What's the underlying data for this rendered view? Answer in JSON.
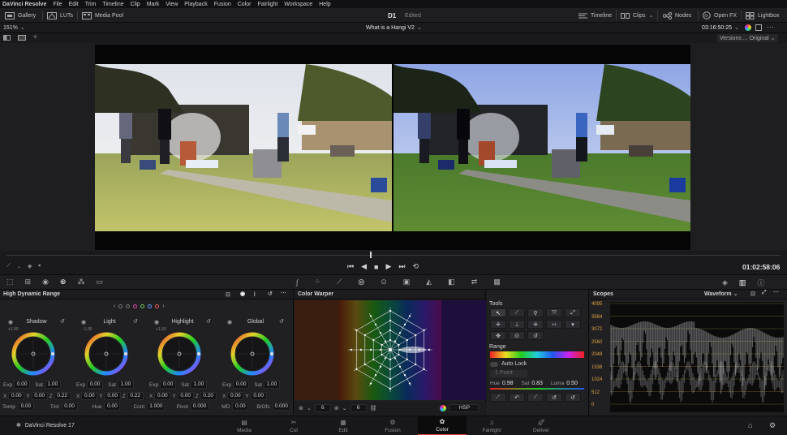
{
  "menubar": {
    "items": [
      "DaVinci Resolve",
      "File",
      "Edit",
      "Trim",
      "Timeline",
      "Clip",
      "Mark",
      "View",
      "Playback",
      "Fusion",
      "Color",
      "Fairlight",
      "Workspace",
      "Help"
    ]
  },
  "toolbar": {
    "gallery": "Gallery",
    "luts": "LUTs",
    "media_pool": "Media Pool",
    "project": "D1",
    "project_status": "Edited",
    "timeline": "Timeline",
    "clips": "Clips",
    "nodes": "Nodes",
    "open_fx": "Open FX",
    "lightbox": "Lightbox"
  },
  "viewer": {
    "zoom": "151%",
    "clip_title": "What is a Hangi V2",
    "timecode": "03:16:50:25",
    "versions": "Versions ... Original",
    "playhead_timecode": "01:02:58:06"
  },
  "hdr": {
    "title": "High Dynamic Range",
    "wheels": [
      {
        "name": "Shadow",
        "offset": "",
        "exp": "0.00",
        "sat": "1.00",
        "x": "0.00",
        "y": "0.00",
        "z": "0.22"
      },
      {
        "name": "Light",
        "offset": "-1.00",
        "exp": "0.00",
        "sat": "1.00",
        "x": "0.00",
        "y": "0.00",
        "z": "0.22"
      },
      {
        "name": "Highlight",
        "offset": "+1.50",
        "exp": "0.00",
        "sat": "1.00",
        "x": "0.00",
        "y": "0.00",
        "z": "0.20"
      },
      {
        "name": "Global",
        "offset": "",
        "exp": "0.00",
        "sat": "1.00",
        "x": "0.00",
        "y": "0.00",
        "z": ""
      }
    ],
    "shadow_offset": "+1.00",
    "bottom": {
      "temp_label": "Temp",
      "temp": "0.00",
      "tint_label": "Tint",
      "tint": "0.00",
      "hue_label": "Hue",
      "hue": "0.00",
      "cont_label": "Cont",
      "cont": "1.000",
      "pivot_label": "Pivot",
      "pivot": "0.000",
      "md_label": "MD",
      "md": "0.00",
      "bofs_label": "B/Ofs",
      "bofs": "0.000"
    },
    "labels": {
      "exp": "Exp",
      "sat": "Sat",
      "x": "X",
      "y": "Y",
      "z": "Z"
    }
  },
  "warper": {
    "title": "Color Warper",
    "grid_a": "6",
    "grid_b": "6",
    "mode": "HSP"
  },
  "tools": {
    "title": "Tools",
    "range": "Range",
    "auto_lock": "Auto Lock",
    "point_hint": "1 Point",
    "hue_label": "Hue",
    "hue": "0.98",
    "sat_label": "Sat",
    "sat": "0.83",
    "luma_label": "Luma",
    "luma": "0.50"
  },
  "scopes": {
    "title": "Scopes",
    "mode": "Waveform",
    "scale": [
      "4095",
      "3584",
      "3072",
      "2560",
      "2048",
      "1536",
      "1024",
      "512",
      "0"
    ]
  },
  "footer": {
    "app": "DaVinci Resolve 17",
    "pages": [
      "Media",
      "Cut",
      "Edit",
      "Fusion",
      "Color",
      "Fairlight",
      "Deliver"
    ],
    "active": "Color"
  },
  "colors": {
    "accent": "#e5453a",
    "playhead": "#f0a035"
  }
}
